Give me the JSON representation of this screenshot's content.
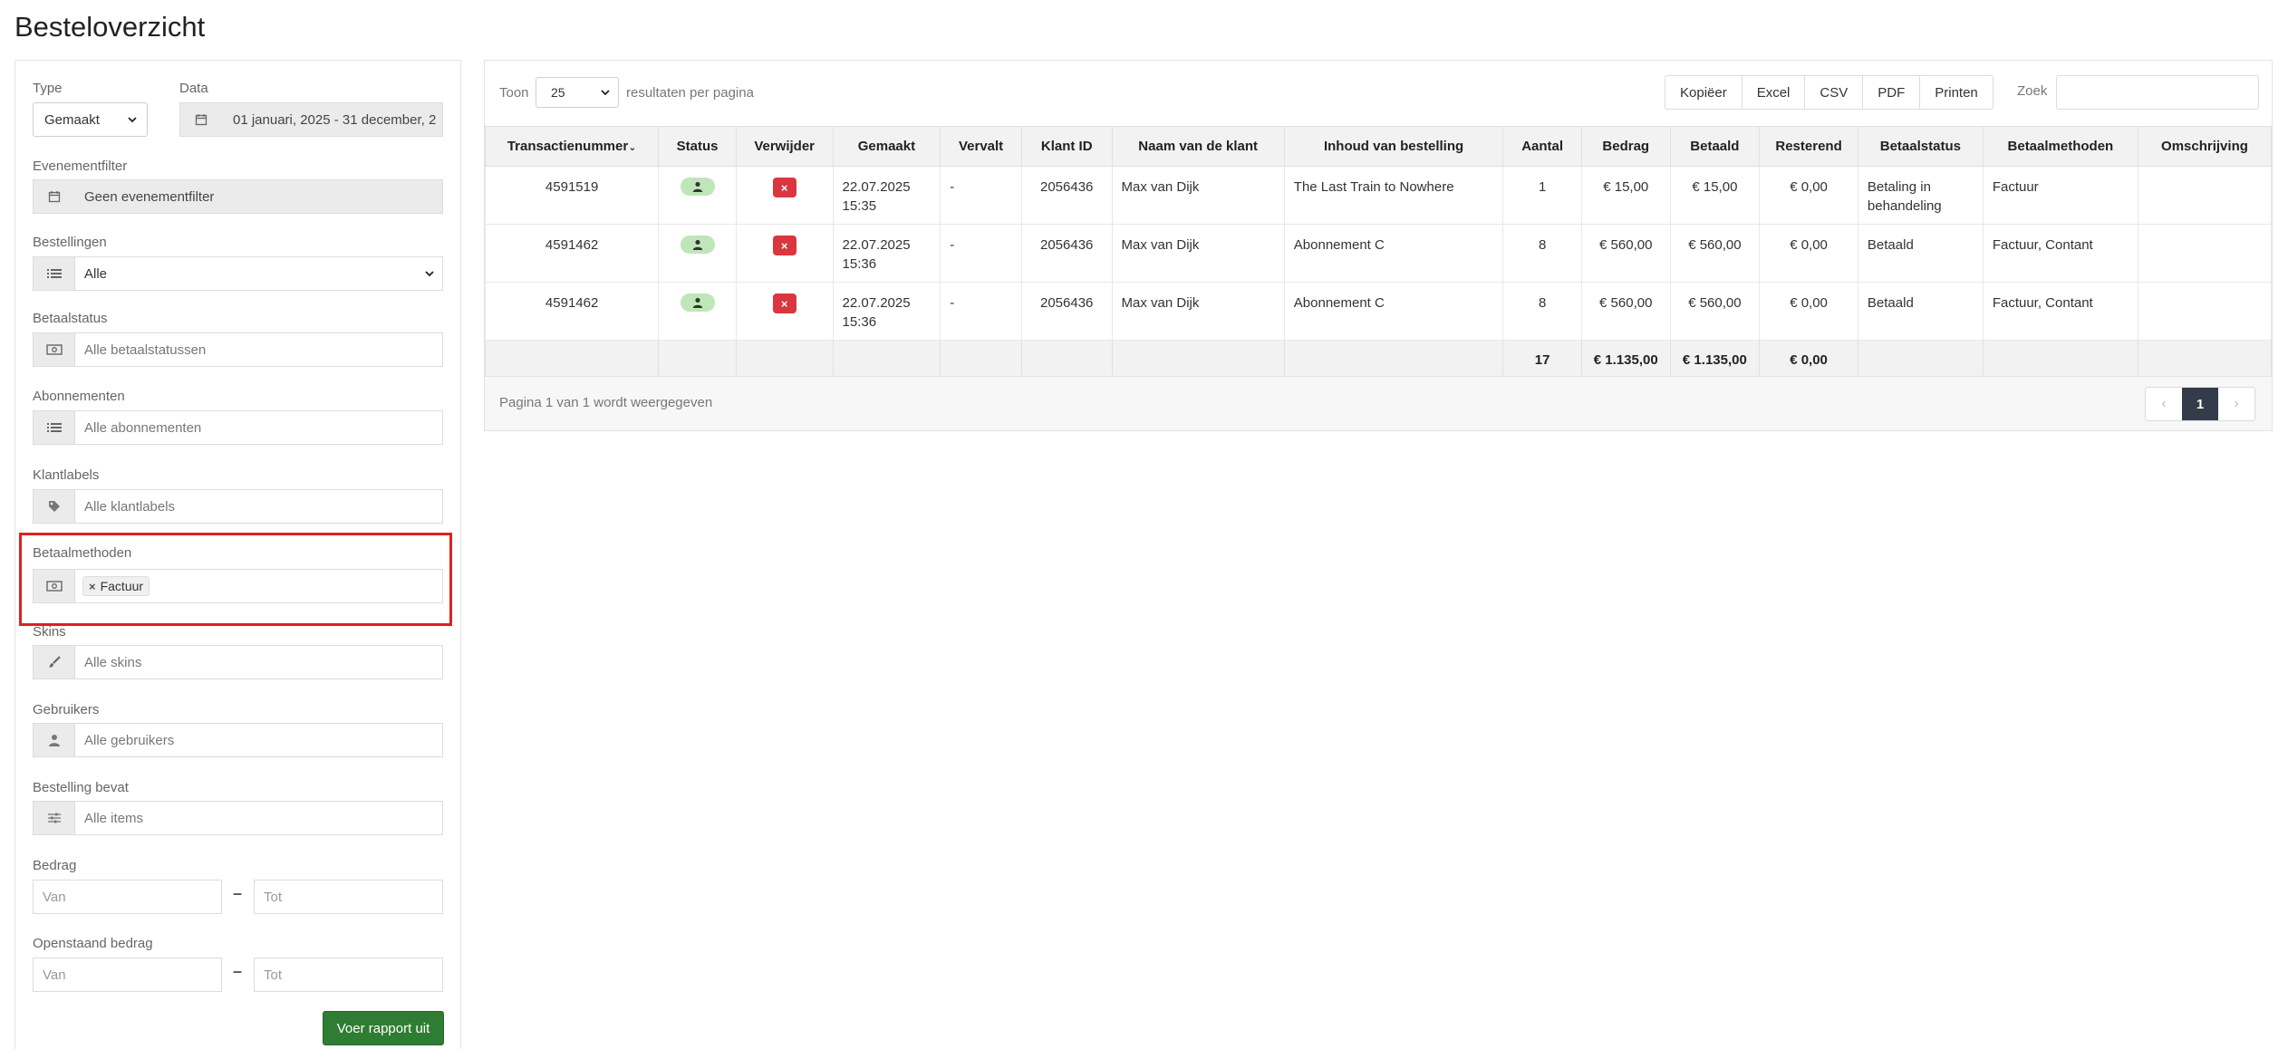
{
  "page": {
    "title": "Besteloverzicht"
  },
  "filters": {
    "type": {
      "label": "Type",
      "value": "Gemaakt"
    },
    "data": {
      "label": "Data",
      "value": "01 januari, 2025 - 31 december, 2"
    },
    "event": {
      "label": "Evenementfilter",
      "value": "Geen evenementfilter"
    },
    "orders": {
      "label": "Bestellingen",
      "value": "Alle"
    },
    "paystatus": {
      "label": "Betaalstatus",
      "placeholder": "Alle betaalstatussen"
    },
    "subscriptions": {
      "label": "Abonnementen",
      "placeholder": "Alle abonnementen"
    },
    "customer_labels": {
      "label": "Klantlabels",
      "placeholder": "Alle klantlabels"
    },
    "pay_methods": {
      "label": "Betaalmethoden",
      "tags": [
        "Factuur"
      ]
    },
    "skins": {
      "label": "Skins",
      "placeholder": "Alle skins"
    },
    "users": {
      "label": "Gebruikers",
      "placeholder": "Alle gebruikers"
    },
    "contains": {
      "label": "Bestelling bevat",
      "placeholder": "Alle items"
    },
    "amount": {
      "label": "Bedrag",
      "from": "Van",
      "to": "Tot"
    },
    "outstanding": {
      "label": "Openstaand bedrag",
      "from": "Van",
      "to": "Tot"
    },
    "run_button": "Voer rapport uit"
  },
  "toolbar": {
    "show": "Toon",
    "page_size": "25",
    "per_page": "resultaten per pagina",
    "export": [
      "Kopiëer",
      "Excel",
      "CSV",
      "PDF",
      "Printen"
    ],
    "search_label": "Zoek"
  },
  "table": {
    "headers": [
      "Transactienummer",
      "Status",
      "Verwijder",
      "Gemaakt",
      "Vervalt",
      "Klant ID",
      "Naam van de klant",
      "Inhoud van bestelling",
      "Aantal",
      "Bedrag",
      "Betaald",
      "Resterend",
      "Betaalstatus",
      "Betaalmethoden",
      "Omschrijving"
    ],
    "rows": [
      {
        "tx": "4591519",
        "created": "22.07.2025 15:35",
        "expires": "-",
        "client_id": "2056436",
        "name": "Max van Dijk",
        "content": "The Last Train to Nowhere",
        "qty": "1",
        "amount": "€ 15,00",
        "paid": "€ 15,00",
        "remaining": "€ 0,00",
        "status": "Betaling in behandeling",
        "methods": "Factuur",
        "desc": ""
      },
      {
        "tx": "4591462",
        "created": "22.07.2025 15:36",
        "expires": "-",
        "client_id": "2056436",
        "name": "Max van Dijk",
        "content": "Abonnement C",
        "qty": "8",
        "amount": "€ 560,00",
        "paid": "€ 560,00",
        "remaining": "€ 0,00",
        "status": "Betaald",
        "methods": "Factuur, Contant",
        "desc": ""
      },
      {
        "tx": "4591462",
        "created": "22.07.2025 15:36",
        "expires": "-",
        "client_id": "2056436",
        "name": "Max van Dijk",
        "content": "Abonnement C",
        "qty": "8",
        "amount": "€ 560,00",
        "paid": "€ 560,00",
        "remaining": "€ 0,00",
        "status": "Betaald",
        "methods": "Factuur, Contant",
        "desc": ""
      }
    ],
    "totals": {
      "qty": "17",
      "amount": "€ 1.135,00",
      "paid": "€ 1.135,00",
      "remaining": "€ 0,00"
    }
  },
  "footer": {
    "info": "Pagina 1 van 1 wordt weergegeven",
    "prev": "‹",
    "current_page": "1",
    "next": "›"
  }
}
